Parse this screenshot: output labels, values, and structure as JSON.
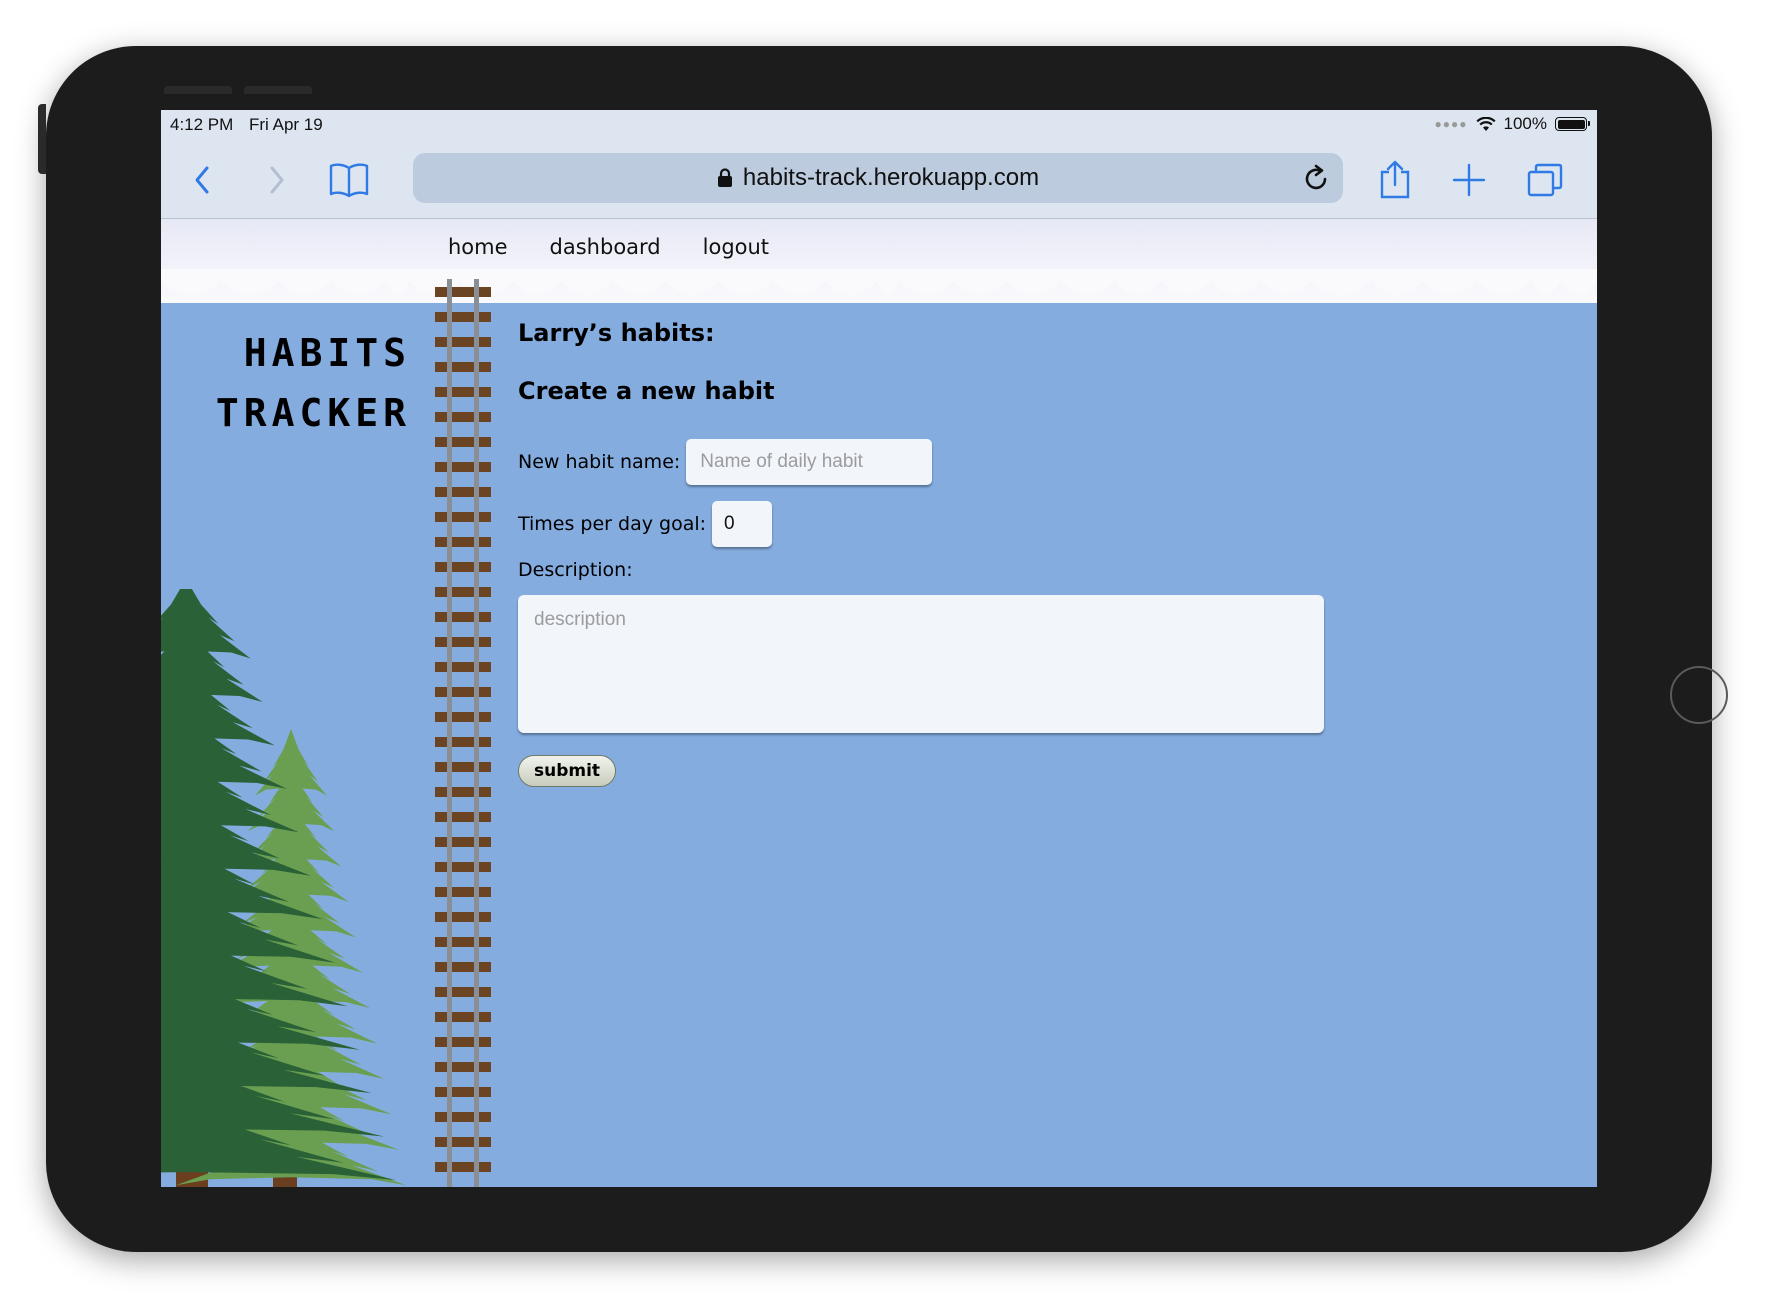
{
  "status_bar": {
    "time": "4:12 PM",
    "date": "Fri Apr 19",
    "battery": "100%",
    "battery_level": 1.0
  },
  "browser": {
    "url": "habits-track.herokuapp.com",
    "icons": [
      "back-icon",
      "forward-icon",
      "bookmarks-icon",
      "lock-icon",
      "reload-icon",
      "share-icon",
      "new-tab-icon",
      "tabs-icon"
    ]
  },
  "nav": {
    "items": [
      {
        "label": "home"
      },
      {
        "label": "dashboard"
      },
      {
        "label": "logout"
      }
    ]
  },
  "logo": {
    "line1": "HABITS",
    "line2": "TRACKER"
  },
  "main": {
    "heading": "Larry’s habits:",
    "form_title": "Create a new habit",
    "name_label": "New habit name:",
    "name_placeholder": "Name of daily habit",
    "goal_label": "Times per day goal:",
    "goal_value": "0",
    "description_label": "Description:",
    "description_placeholder": "description",
    "submit_label": "submit"
  },
  "colors": {
    "sky": "#84acdf",
    "tree_dark": "#2a6136",
    "tree_light": "#6a9f52",
    "trunk": "#6b3e1f",
    "track_tie": "#6b4423"
  }
}
